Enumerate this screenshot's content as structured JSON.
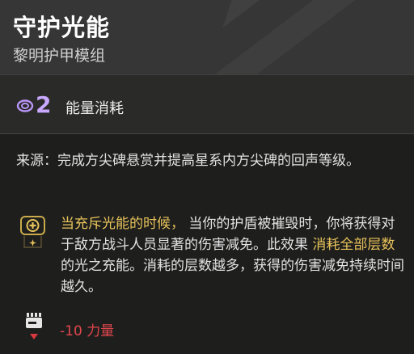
{
  "header": {
    "title": "守护光能",
    "subtitle": "黎明护甲模组"
  },
  "energy": {
    "icon": "void-energy-icon",
    "cost": "2",
    "label": "能量消耗",
    "accent_color": "#c9a8ff"
  },
  "source": {
    "text": "来源：完成方尖碑悬赏并提高星系内方尖碑的回声等级。"
  },
  "perk": {
    "icon": "charged-with-light-icon",
    "highlight1": "当充斥光能的时候，",
    "text1": "当你的护盾被摧毁时，你将获得对于敌方战斗人员显著的伤害减免。此效果",
    "highlight2": "消耗全部层数",
    "text2": "的光之充能。消耗的层数越多，获得的伤害减免持续时间越久。",
    "highlight_color": "#e8c35a"
  },
  "stat": {
    "icon": "strength-stat-icon",
    "text": "-10 力量",
    "color": "#e0474d"
  }
}
